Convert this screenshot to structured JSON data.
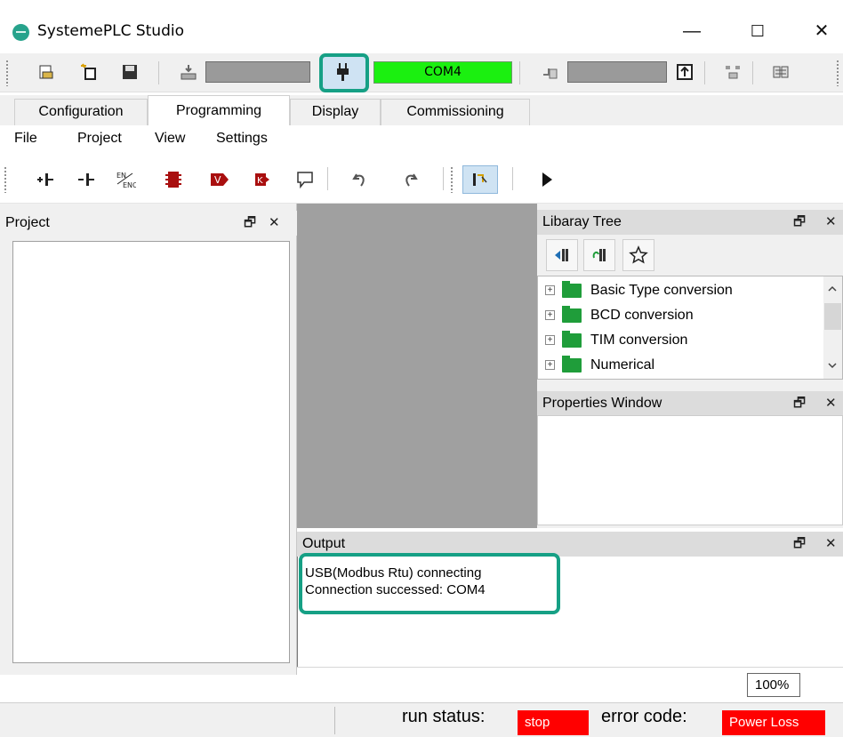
{
  "window": {
    "title": "SystemePLC Studio",
    "minimize_glyph": "—",
    "maximize_glyph": "☐",
    "close_glyph": "✕"
  },
  "main_toolbar": {
    "connection_port": "COM4",
    "connect_icon": "plug-icon"
  },
  "tabs": [
    {
      "label": "Configuration"
    },
    {
      "label": "Programming"
    },
    {
      "label": "Display"
    },
    {
      "label": "Commissioning"
    }
  ],
  "menu": [
    {
      "label": "File"
    },
    {
      "label": "Project"
    },
    {
      "label": "View"
    },
    {
      "label": "Settings"
    }
  ],
  "prog_toolbar": {
    "en_eno_label": "EN ENO",
    "v_label": "V",
    "k_label": "K"
  },
  "panels": {
    "project_title": "Project",
    "library_title": "Libaray Tree",
    "properties_title": "Properties Window",
    "output_title": "Output",
    "float_glyph": "🗗",
    "close_glyph": "✕"
  },
  "library_tree": {
    "items": [
      {
        "label": "Basic Type conversion"
      },
      {
        "label": "BCD conversion"
      },
      {
        "label": "TIM conversion"
      },
      {
        "label": "Numerical"
      }
    ]
  },
  "output": {
    "lines": [
      "USB(Modbus Rtu) connecting",
      "Connection successed: COM4"
    ]
  },
  "zoom": "100%",
  "status": {
    "run_label": "run status:",
    "run_value": "stop",
    "error_label": "error code:",
    "error_value": "Power Loss",
    "colors": {
      "alert": "#ff0000",
      "connected": "#1bf010",
      "highlight": "#16a085"
    }
  }
}
